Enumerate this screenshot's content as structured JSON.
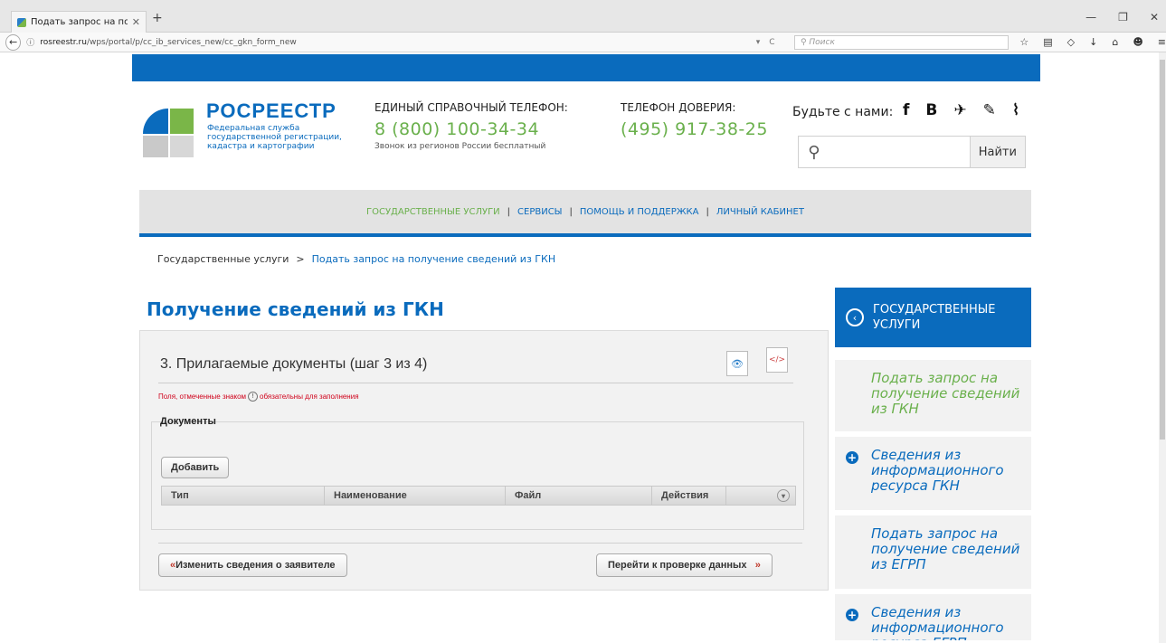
{
  "browser": {
    "tab_title": "Подать запрос на получе...",
    "tab_close": "✕",
    "new_tab": "+",
    "controls": [
      "—",
      "❐",
      "✕"
    ],
    "back": "←",
    "url_domain": "rosreestr.ru",
    "url_path": "/wps/portal/p/cc_ib_services_new/cc_gkn_form_new",
    "url_icons": [
      "▾",
      "C"
    ],
    "search_placeholder": "Поиск",
    "toolbar_icons": [
      "☆",
      "▤",
      "◇",
      "↓",
      "⌂",
      "☻",
      "≡"
    ]
  },
  "header": {
    "logo_title": "РОСРЕЕСТР",
    "logo_subtitle": "Федеральная служба государственной регистрации, кадастра и картографии",
    "phone1_label": "ЕДИНЫЙ СПРАВОЧНЫЙ ТЕЛЕФОН:",
    "phone1": "8 (800) 100-34-34",
    "phone1_note": "Звонок из регионов России бесплатный",
    "phone2_label": "ТЕЛЕФОН ДОВЕРИЯ:",
    "phone2": "(495) 917-38-25",
    "social_label": "Будьте с нами:",
    "social_icons": [
      "f",
      "B",
      "✈",
      "✎",
      "⌇"
    ],
    "search_button": "Найти",
    "search_icon": "⚲"
  },
  "menu": {
    "items": [
      "ГОСУДАРСТВЕННЫЕ УСЛУГИ",
      "СЕРВИСЫ",
      "ПОМОЩЬ И ПОДДЕРЖКА",
      "ЛИЧНЫЙ КАБИНЕТ"
    ],
    "separator": "|"
  },
  "breadcrumb": {
    "root": "Государственные услуги",
    "sep": ">",
    "current": "Подать запрос на получение сведений из ГКН"
  },
  "page_title": "Получение сведений из ГКН",
  "form": {
    "step_title": "3. Прилагаемые документы (шаг 3 из 4)",
    "required_note_before": "Поля, отмеченные знаком",
    "required_mark": "!",
    "required_note_after": "обязательны для заполнения",
    "documents_legend": "Документы",
    "add_button": "Добавить",
    "columns": [
      "Тип",
      "Наименование",
      "Файл",
      "Действия"
    ],
    "prev_arrow": "«",
    "prev_button": "Изменить сведения о заявителе",
    "next_button": "Перейти к проверке данных",
    "next_arrow": "»",
    "preview_icon": "👁",
    "code_icon": "</>",
    "grid_menu": "▾"
  },
  "sidebar": {
    "header": "ГОСУДАРСТВЕННЫЕ УСЛУГИ",
    "header_icon": "‹",
    "items": [
      {
        "label": "Подать запрос на получение сведений из ГКН",
        "icon": ""
      },
      {
        "label": "Сведения из информационного ресурса ГКН",
        "icon": "+"
      },
      {
        "label": "Подать запрос на получение сведений из ЕГРП",
        "icon": ""
      },
      {
        "label": "Сведения из информационного ресурса ЕГРП",
        "icon": "+"
      }
    ]
  },
  "colors": {
    "brand_blue": "#0a6bbd",
    "brand_green": "#6ab04c",
    "required_red": "#d0021b"
  }
}
